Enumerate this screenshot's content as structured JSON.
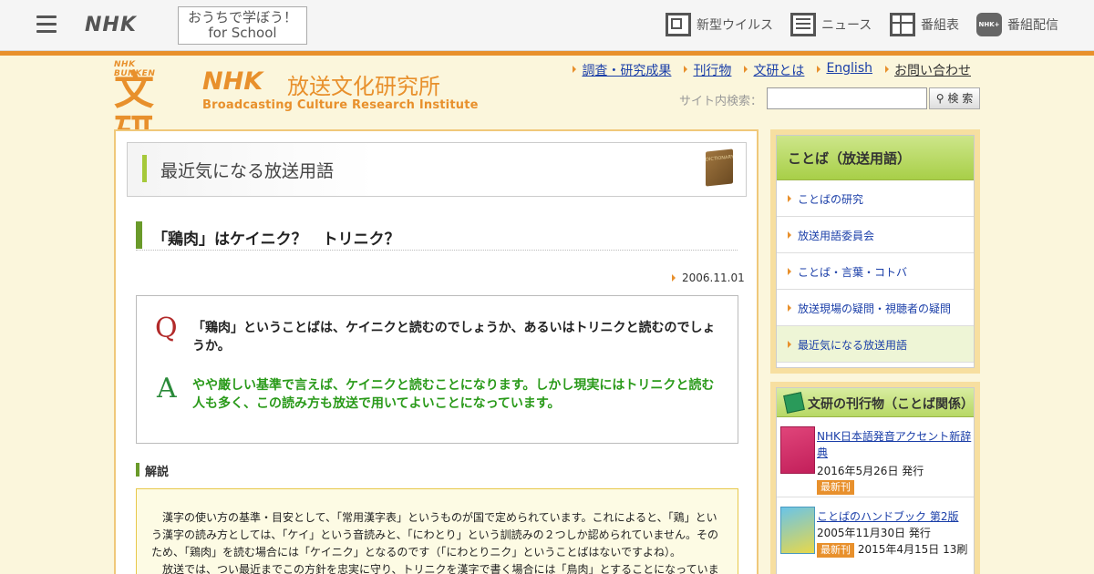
{
  "topbar": {
    "nhk": "NHK",
    "school_line1": "おうちで学ぼう！",
    "school_line2": "for School",
    "nav": [
      {
        "label": "新型ウイルス",
        "icon": "virus-news-icon"
      },
      {
        "label": "ニュース",
        "icon": "news-icon"
      },
      {
        "label": "番組表",
        "icon": "program-guide-icon"
      },
      {
        "label": "番組配信",
        "icon": "nhk-plus-icon",
        "icon_text": "NHK+"
      }
    ]
  },
  "header": {
    "logo_small": "NHK BUNKEN",
    "logo_big": "文研",
    "logo_nhk": "NHK",
    "logo_institute": "放送文化研究所",
    "logo_english": "Broadcasting Culture Research Institute",
    "links": [
      "調査・研究成果",
      "刊行物",
      "文研とは",
      "English",
      "お問い合わせ"
    ],
    "search_label": "サイト内検索：",
    "search_button": "検 索"
  },
  "main": {
    "section_title": "最近気になる放送用語",
    "book_icon_text": "DICTIONARY",
    "question_title": "「鶏肉」はケイニク？　トリニク？",
    "date": "2006.11.01",
    "q_letter": "Q",
    "question": "「鶏肉」ということばは、ケイニクと読むのでしょうか、あるいはトリニクと読むのでしょうか。",
    "a_letter": "A",
    "answer": "やや厳しい基準で言えば、ケイニクと読むことになります。しかし現実にはトリニクと読む人も多く、この読み方も放送で用いてよいことになっています。",
    "commentary_heading": "解説",
    "commentary": "　漢字の使い方の基準・目安として、「常用漢字表」というものが国で定められています。これによると、「鶏」という漢字の読み方としては、「ケイ」という音読みと、「にわとり」という訓読みの２つしか認められていません。そのため、「鶏肉」を読む場合には「ケイニク」となるのです（「にわとりニク」ということばはないですよね）。\n　放送では、つい最近までこの方針を忠実に守り、トリニクを漢字で書く場合には「鳥肉」とすることになっていま"
  },
  "sidebar": {
    "kotoba_heading": "ことば（放送用語）",
    "kotoba_items": [
      {
        "label": "ことばの研究"
      },
      {
        "label": "放送用語委員会"
      },
      {
        "label": "ことば・言葉・コトバ"
      },
      {
        "label": "放送現場の疑問・視聴者の疑問"
      },
      {
        "label": "最近気になる放送用語"
      }
    ],
    "pubs_heading": "文研の刊行物（ことば関係）",
    "pubs": [
      {
        "title": "NHK日本語発音アクセント新辞典",
        "date": "2016年5月26日 発行",
        "badge": "最新刊",
        "extra": ""
      },
      {
        "title": "ことばのハンドブック 第2版",
        "date": "2005年11月30日 発行",
        "badge": "最新刊",
        "extra": "2015年4月15日 13刷"
      }
    ]
  }
}
